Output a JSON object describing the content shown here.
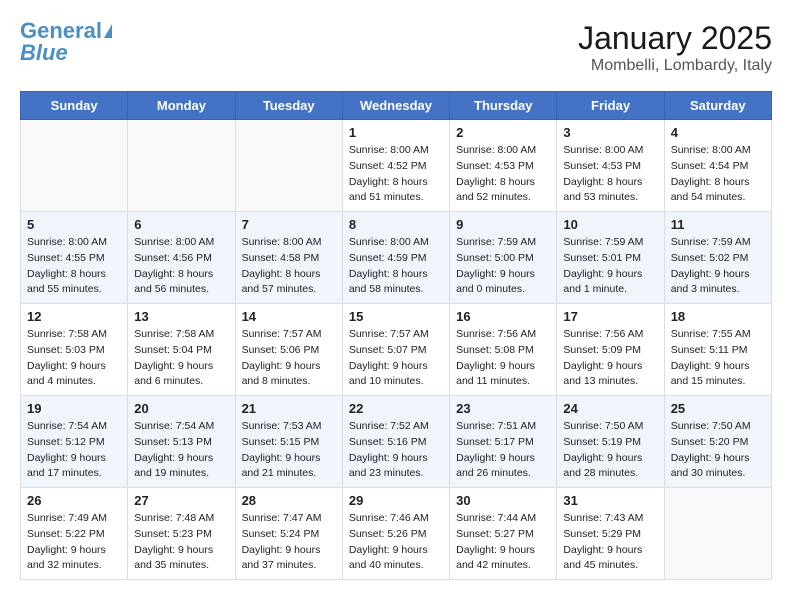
{
  "logo": {
    "line1": "General",
    "line2": "Blue"
  },
  "title": "January 2025",
  "subtitle": "Mombelli, Lombardy, Italy",
  "weekdays": [
    "Sunday",
    "Monday",
    "Tuesday",
    "Wednesday",
    "Thursday",
    "Friday",
    "Saturday"
  ],
  "weeks": [
    [
      {
        "day": "",
        "info": ""
      },
      {
        "day": "",
        "info": ""
      },
      {
        "day": "",
        "info": ""
      },
      {
        "day": "1",
        "info": "Sunrise: 8:00 AM\nSunset: 4:52 PM\nDaylight: 8 hours and 51 minutes."
      },
      {
        "day": "2",
        "info": "Sunrise: 8:00 AM\nSunset: 4:53 PM\nDaylight: 8 hours and 52 minutes."
      },
      {
        "day": "3",
        "info": "Sunrise: 8:00 AM\nSunset: 4:53 PM\nDaylight: 8 hours and 53 minutes."
      },
      {
        "day": "4",
        "info": "Sunrise: 8:00 AM\nSunset: 4:54 PM\nDaylight: 8 hours and 54 minutes."
      }
    ],
    [
      {
        "day": "5",
        "info": "Sunrise: 8:00 AM\nSunset: 4:55 PM\nDaylight: 8 hours and 55 minutes."
      },
      {
        "day": "6",
        "info": "Sunrise: 8:00 AM\nSunset: 4:56 PM\nDaylight: 8 hours and 56 minutes."
      },
      {
        "day": "7",
        "info": "Sunrise: 8:00 AM\nSunset: 4:58 PM\nDaylight: 8 hours and 57 minutes."
      },
      {
        "day": "8",
        "info": "Sunrise: 8:00 AM\nSunset: 4:59 PM\nDaylight: 8 hours and 58 minutes."
      },
      {
        "day": "9",
        "info": "Sunrise: 7:59 AM\nSunset: 5:00 PM\nDaylight: 9 hours and 0 minutes."
      },
      {
        "day": "10",
        "info": "Sunrise: 7:59 AM\nSunset: 5:01 PM\nDaylight: 9 hours and 1 minute."
      },
      {
        "day": "11",
        "info": "Sunrise: 7:59 AM\nSunset: 5:02 PM\nDaylight: 9 hours and 3 minutes."
      }
    ],
    [
      {
        "day": "12",
        "info": "Sunrise: 7:58 AM\nSunset: 5:03 PM\nDaylight: 9 hours and 4 minutes."
      },
      {
        "day": "13",
        "info": "Sunrise: 7:58 AM\nSunset: 5:04 PM\nDaylight: 9 hours and 6 minutes."
      },
      {
        "day": "14",
        "info": "Sunrise: 7:57 AM\nSunset: 5:06 PM\nDaylight: 9 hours and 8 minutes."
      },
      {
        "day": "15",
        "info": "Sunrise: 7:57 AM\nSunset: 5:07 PM\nDaylight: 9 hours and 10 minutes."
      },
      {
        "day": "16",
        "info": "Sunrise: 7:56 AM\nSunset: 5:08 PM\nDaylight: 9 hours and 11 minutes."
      },
      {
        "day": "17",
        "info": "Sunrise: 7:56 AM\nSunset: 5:09 PM\nDaylight: 9 hours and 13 minutes."
      },
      {
        "day": "18",
        "info": "Sunrise: 7:55 AM\nSunset: 5:11 PM\nDaylight: 9 hours and 15 minutes."
      }
    ],
    [
      {
        "day": "19",
        "info": "Sunrise: 7:54 AM\nSunset: 5:12 PM\nDaylight: 9 hours and 17 minutes."
      },
      {
        "day": "20",
        "info": "Sunrise: 7:54 AM\nSunset: 5:13 PM\nDaylight: 9 hours and 19 minutes."
      },
      {
        "day": "21",
        "info": "Sunrise: 7:53 AM\nSunset: 5:15 PM\nDaylight: 9 hours and 21 minutes."
      },
      {
        "day": "22",
        "info": "Sunrise: 7:52 AM\nSunset: 5:16 PM\nDaylight: 9 hours and 23 minutes."
      },
      {
        "day": "23",
        "info": "Sunrise: 7:51 AM\nSunset: 5:17 PM\nDaylight: 9 hours and 26 minutes."
      },
      {
        "day": "24",
        "info": "Sunrise: 7:50 AM\nSunset: 5:19 PM\nDaylight: 9 hours and 28 minutes."
      },
      {
        "day": "25",
        "info": "Sunrise: 7:50 AM\nSunset: 5:20 PM\nDaylight: 9 hours and 30 minutes."
      }
    ],
    [
      {
        "day": "26",
        "info": "Sunrise: 7:49 AM\nSunset: 5:22 PM\nDaylight: 9 hours and 32 minutes."
      },
      {
        "day": "27",
        "info": "Sunrise: 7:48 AM\nSunset: 5:23 PM\nDaylight: 9 hours and 35 minutes."
      },
      {
        "day": "28",
        "info": "Sunrise: 7:47 AM\nSunset: 5:24 PM\nDaylight: 9 hours and 37 minutes."
      },
      {
        "day": "29",
        "info": "Sunrise: 7:46 AM\nSunset: 5:26 PM\nDaylight: 9 hours and 40 minutes."
      },
      {
        "day": "30",
        "info": "Sunrise: 7:44 AM\nSunset: 5:27 PM\nDaylight: 9 hours and 42 minutes."
      },
      {
        "day": "31",
        "info": "Sunrise: 7:43 AM\nSunset: 5:29 PM\nDaylight: 9 hours and 45 minutes."
      },
      {
        "day": "",
        "info": ""
      }
    ]
  ]
}
